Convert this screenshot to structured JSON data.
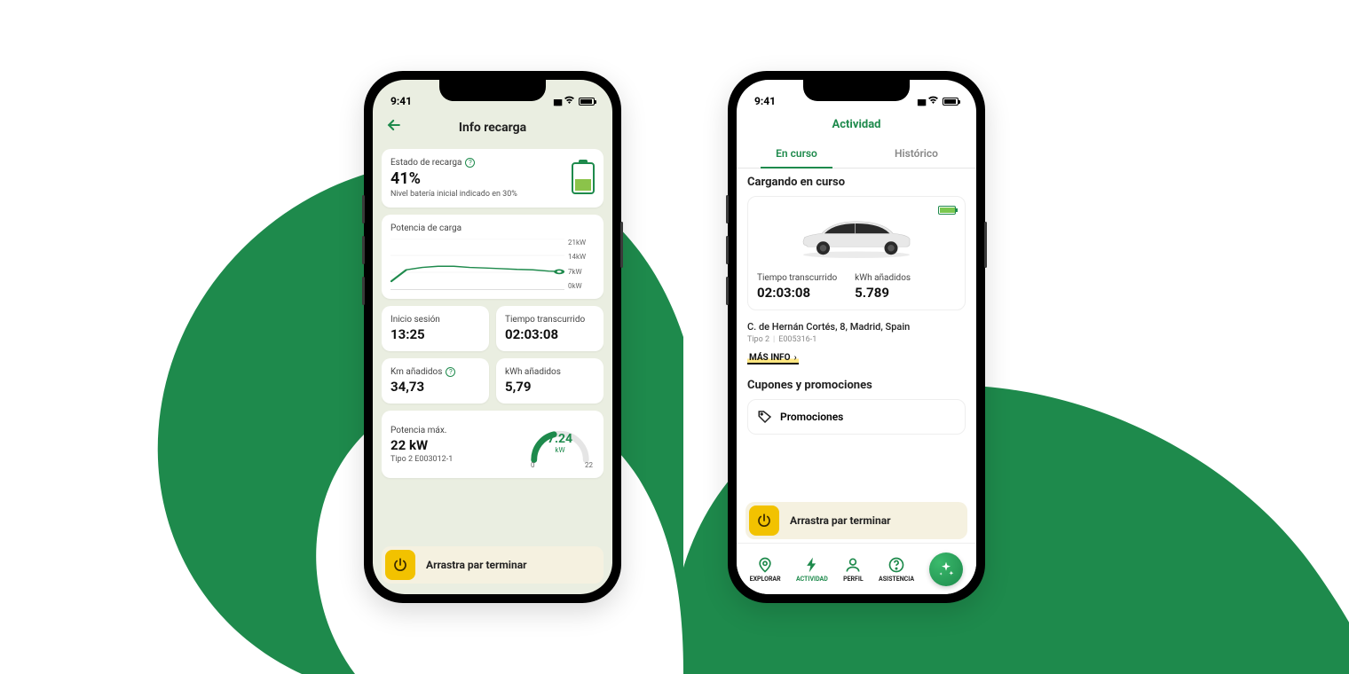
{
  "colors": {
    "accent": "#1e8a4c",
    "yellow": "#f2c200"
  },
  "status": {
    "time": "9:41"
  },
  "left": {
    "header": {
      "title": "Info recarga"
    },
    "state": {
      "label": "Estado de recarga",
      "value": "41%",
      "sub": "Nivel batería inicial indicado en 30%"
    },
    "chart": {
      "label": "Potencia de carga"
    },
    "session_start": {
      "label": "Inicio sesión",
      "value": "13:25"
    },
    "elapsed": {
      "label": "Tiempo transcurrido",
      "value": "02:03:08"
    },
    "km_added": {
      "label": "Km añadidos",
      "value": "34,73"
    },
    "kwh_added": {
      "label": "kWh añadidos",
      "value": "5,79"
    },
    "max_power": {
      "label": "Potencia máx.",
      "value": "22 kW",
      "sub": "Tipo 2 E003012-1"
    },
    "gauge": {
      "value": "7.24",
      "unit": "kW",
      "lo": "0",
      "hi": "22"
    },
    "slider": {
      "text": "Arrastra par terminar"
    }
  },
  "right": {
    "header": {
      "title": "Actividad"
    },
    "tabs": {
      "active": "En curso",
      "inactive": "Histórico"
    },
    "section_title": "Cargando en curso",
    "elapsed": {
      "label": "Tiempo transcurrido",
      "value": "02:03:08"
    },
    "kwh": {
      "label": "kWh añadidos",
      "value": "5.789"
    },
    "address": "C. de Hernán Cortés, 8, Madrid, Spain",
    "connector": "Tipo 2",
    "charger_id": "E005316-1",
    "more": "MÁS INFO",
    "coupons_title": "Cupones y promociones",
    "coupon_label": "Promociones",
    "slider": {
      "text": "Arrastra par terminar"
    },
    "nav": {
      "explore": "EXPLORAR",
      "activity": "ACTIVIDAD",
      "profile": "PERFIL",
      "help": "ASISTENCIA"
    }
  },
  "chart_data": {
    "type": "line",
    "title": "Potencia de carga",
    "ylabel": "kW",
    "ylim": [
      0,
      21
    ],
    "y_ticks": [
      "21kW",
      "14kW",
      "7kW",
      "0kW"
    ],
    "x": [
      0,
      1,
      2,
      3,
      4,
      5,
      6,
      7,
      8,
      9,
      10,
      11
    ],
    "values": [
      3,
      8,
      9,
      9.5,
      9.5,
      9,
      8.8,
      8.5,
      8.2,
      8,
      7.5,
      7.24
    ],
    "current_value": 7.24
  }
}
